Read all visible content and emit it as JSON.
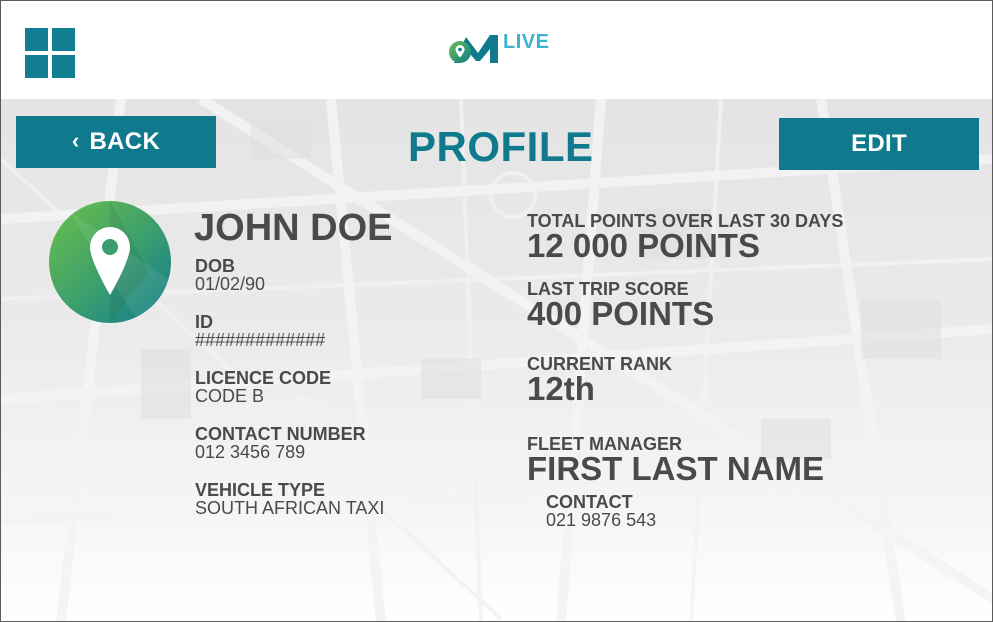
{
  "header": {
    "logo_text": "LIVE",
    "menu_icon": "grid-icon",
    "accent_color": "#0f7a8e"
  },
  "nav": {
    "back_label": "BACK",
    "edit_label": "EDIT",
    "page_title": "PROFILE"
  },
  "profile": {
    "name": "JOHN DOE",
    "fields": [
      {
        "label": "DOB",
        "value": "01/02/90"
      },
      {
        "label": "ID",
        "value": "#############"
      },
      {
        "label": "LICENCE CODE",
        "value": "CODE B"
      },
      {
        "label": "CONTACT NUMBER",
        "value": "012 3456 789"
      },
      {
        "label": "VEHICLE TYPE",
        "value": "SOUTH AFRICAN TAXI"
      }
    ]
  },
  "stats": {
    "total_points_label": "TOTAL POINTS OVER LAST 30 DAYS",
    "total_points_value": "12 000 POINTS",
    "last_trip_label": "LAST TRIP SCORE",
    "last_trip_value": "400 POINTS",
    "rank_label": "CURRENT RANK",
    "rank_value": "12th",
    "fleet_manager_label": "FLEET MANAGER",
    "fleet_manager_value": "FIRST LAST NAME",
    "contact_label": "CONTACT",
    "contact_value": "021 9876 543"
  }
}
